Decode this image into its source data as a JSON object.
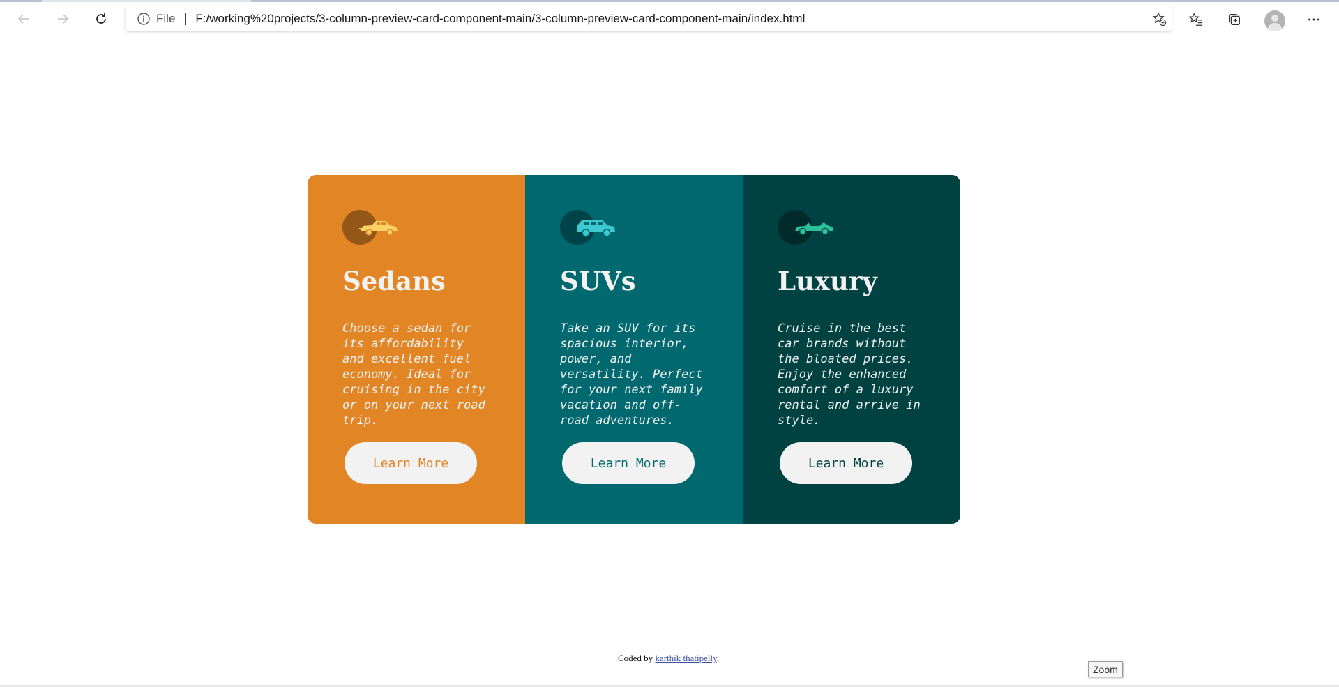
{
  "browser": {
    "address": {
      "scheme_label": "File",
      "url": "F:/working%20projects/3-column-preview-card-component-main/3-column-preview-card-component-main/index.html"
    },
    "icons": {
      "back": "arrow-left-icon",
      "forward": "arrow-right-icon",
      "refresh": "refresh-icon",
      "info": "info-icon",
      "add_favorite": "star-plus-icon",
      "favorites": "favorites-icon",
      "collections": "collections-icon",
      "profile": "avatar",
      "menu": "more-icon"
    }
  },
  "cards": [
    {
      "title": "Sedans",
      "text": "Choose a sedan for its affordability and excellent fuel economy. Ideal for cruising in the city or on your next road trip.",
      "button": "Learn More",
      "color": "#e28625",
      "icon": "sedan-icon"
    },
    {
      "title": "SUVs",
      "text": "Take an SUV for its spacious interior, power, and versatility. Perfect for your next family vacation and off-road adventures.",
      "button": "Learn More",
      "color": "#006970",
      "icon": "suv-icon"
    },
    {
      "title": "Luxury",
      "text": "Cruise in the best car brands without the bloated prices. Enjoy the enhanced comfort of a luxury rental and arrive in style.",
      "button": "Learn More",
      "color": "#004241",
      "icon": "luxury-car-icon"
    }
  ],
  "attribution": {
    "prefix": "Coded by",
    "author": "karthik thatipelly",
    "suffix": "."
  },
  "zoom_tooltip": "Zoom",
  "colors": {
    "text_light": "#f2f2f2",
    "sedan_icon": "#ffd166",
    "suv_icon": "#3cc9d0",
    "luxury_icon": "#2bbf9a"
  }
}
